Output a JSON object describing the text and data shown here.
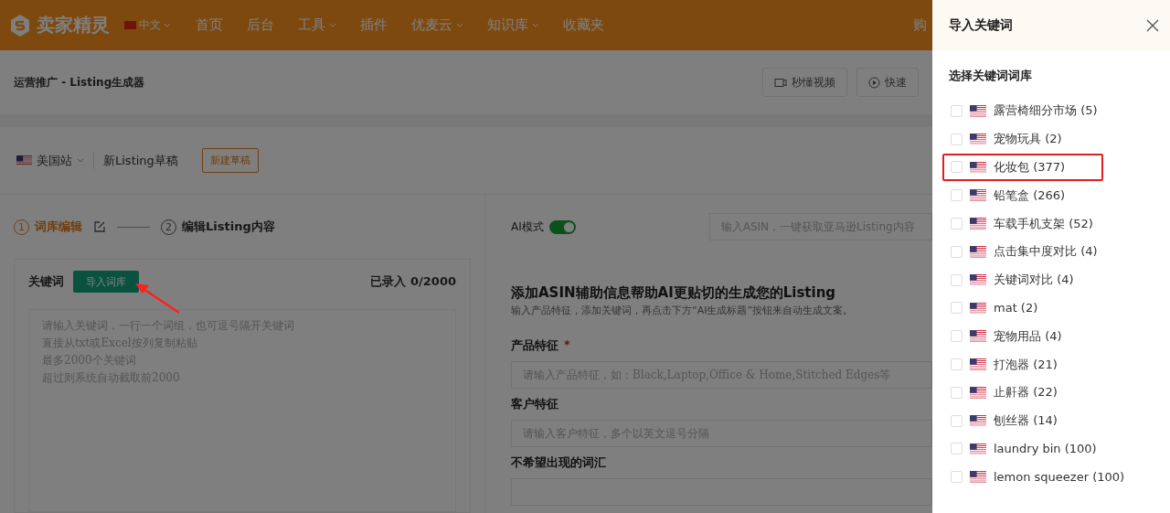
{
  "header": {
    "brand": "卖家精灵",
    "language": "中文",
    "nav": [
      {
        "label": "首页",
        "kind": "link"
      },
      {
        "label": "后台",
        "kind": "link"
      },
      {
        "label": "工具",
        "kind": "dropdown"
      },
      {
        "label": "插件",
        "kind": "link"
      },
      {
        "label": "优麦云",
        "kind": "dropdown"
      },
      {
        "label": "知识库",
        "kind": "dropdown"
      },
      {
        "label": "收藏夹",
        "kind": "link"
      }
    ],
    "right_link": "购"
  },
  "breadcrumb": {
    "title": "运营推广 - Listing生成器",
    "buttons": [
      {
        "label": "秒懂视频",
        "kind": "video"
      },
      {
        "label": "快速",
        "kind": "play"
      }
    ]
  },
  "toolbar": {
    "site": "美国站",
    "draft": "新Listing草稿",
    "new_button": "新建草稿"
  },
  "steps": [
    {
      "number": "1",
      "label": "词库编辑",
      "selected": true
    },
    {
      "number": "2",
      "label": "编辑Listing内容",
      "selected": false
    }
  ],
  "keywords": {
    "label": "关键词",
    "import_button": "导入词库",
    "count": "已录入 0/2000",
    "placeholder_lines": [
      "请输入关键词，一行一个词组，也可逗号隔开关键词",
      "直接从txt或Excel按列复制粘贴",
      "最多2000个关键词",
      "超过则系统自动截取前2000"
    ]
  },
  "ai": {
    "label": "AI模式",
    "required_mark": "*",
    "on": true,
    "asin_placeholder": "输入ASIN，一键获取亚马逊Listing内容",
    "heading": "添加ASIN辅助信息帮助AI更贴切的生成您的Listing",
    "subtitle": "输入产品特征，添加关键词，再点击下方“AI生成标题”按钮来自动生成文案。",
    "fields": [
      {
        "label": "产品特征",
        "required": true,
        "placeholder": "请输入产品特征，如：Black,Laptop,Office & Home,Stitched Edges等"
      },
      {
        "label": "客户特征",
        "placeholder": "请输入客户特征，多个以英文逗号分隔"
      },
      {
        "label": "不希望出现的词汇"
      }
    ]
  },
  "drawer": {
    "title": "导入关键词",
    "section": "选择关键词词库",
    "items": [
      {
        "label": "露营椅细分市场 (5)",
        "checked": false,
        "highlighted": false
      },
      {
        "label": "宠物玩具 (2)",
        "checked": false,
        "highlighted": false
      },
      {
        "label": "化妆包 (377)",
        "checked": false,
        "highlighted": true
      },
      {
        "label": "铅笔盒 (266)",
        "checked": false,
        "highlighted": false
      },
      {
        "label": "车载手机支架 (52)",
        "checked": false,
        "highlighted": false
      },
      {
        "label": "点击集中度对比 (4)",
        "checked": false,
        "highlighted": false
      },
      {
        "label": "关键词对比 (4)",
        "checked": false,
        "highlighted": false
      },
      {
        "label": "mat (2)",
        "checked": false,
        "highlighted": false
      },
      {
        "label": "宠物用品 (4)",
        "checked": false,
        "highlighted": false
      },
      {
        "label": "打泡器 (21)",
        "checked": false,
        "highlighted": false
      },
      {
        "label": "止鼾器 (22)",
        "checked": false,
        "highlighted": false
      },
      {
        "label": "刨丝器 (14)",
        "checked": false,
        "highlighted": false
      },
      {
        "label": "laundry bin (100)",
        "checked": false,
        "highlighted": false
      },
      {
        "label": "lemon squeezer (100)",
        "checked": false,
        "highlighted": false
      }
    ]
  }
}
